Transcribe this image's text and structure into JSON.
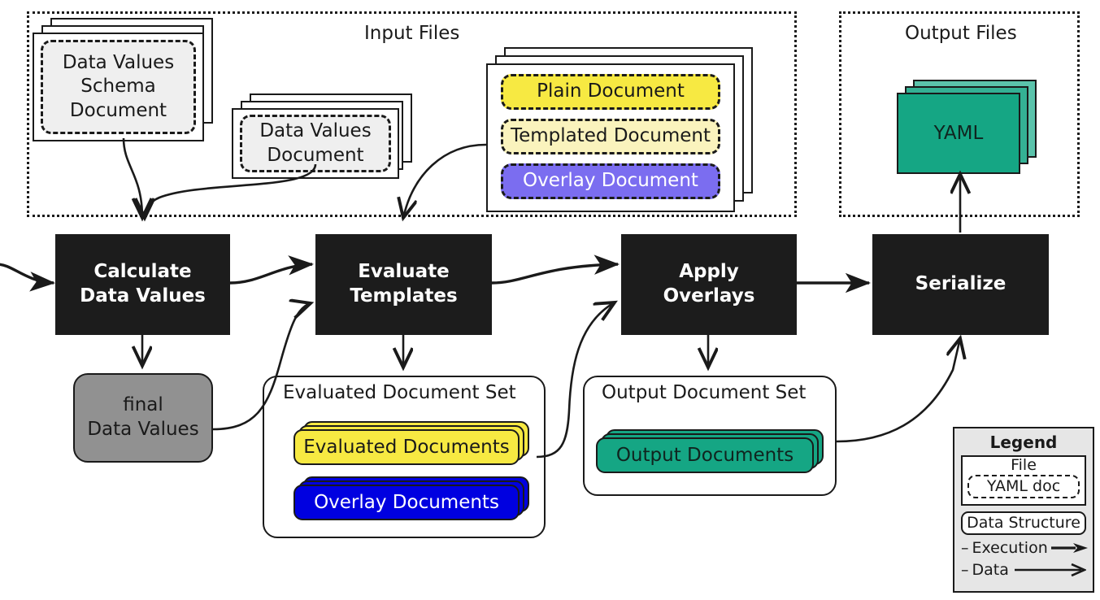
{
  "groups": {
    "input": {
      "title": "Input Files"
    },
    "output": {
      "title": "Output Files"
    }
  },
  "input_files": [
    {
      "name": "data-values-schema-document",
      "label": "Data Values\nSchema\nDocument",
      "style": "plain-dashed"
    },
    {
      "name": "data-values-document",
      "label": "Data Values\nDocument",
      "style": "plain-dashed"
    }
  ],
  "template_file": {
    "docs": [
      {
        "name": "plain-document",
        "label": "Plain Document",
        "color": "#f7e942"
      },
      {
        "name": "templated-document",
        "label": "Templated Document",
        "color": "#faf3bd"
      },
      {
        "name": "overlay-document",
        "label": "Overlay Document",
        "color": "#7b6df0"
      }
    ]
  },
  "output_file": {
    "label": "YAML",
    "color": "#15a684"
  },
  "processes": [
    {
      "name": "calculate-data-values",
      "line1": "Calculate",
      "line2": "Data Values"
    },
    {
      "name": "evaluate-templates",
      "line1": "Evaluate",
      "line2": "Templates"
    },
    {
      "name": "apply-overlays",
      "line1": "Apply",
      "line2": "Overlays"
    },
    {
      "name": "serialize",
      "line1": "Serialize",
      "line2": ""
    }
  ],
  "data_structures": {
    "final_data_values": {
      "line1": "final",
      "line2": "Data Values",
      "color": "#919191"
    },
    "evaluated_document_set": {
      "title": "Evaluated Document Set",
      "chips": [
        {
          "name": "evaluated-documents",
          "label": "Evaluated Documents",
          "color": "#f7e942"
        },
        {
          "name": "overlay-documents",
          "label": "Overlay Documents",
          "color": "#0000e0"
        }
      ]
    },
    "output_document_set": {
      "title": "Output Document Set",
      "chips": [
        {
          "name": "output-documents",
          "label": "Output Documents",
          "color": "#15a684"
        }
      ]
    }
  },
  "legend": {
    "title": "Legend",
    "file_label": "File",
    "yaml_doc_label": "YAML doc",
    "data_structure_label": "Data Structure",
    "execution_dash": "–",
    "execution_label": "Execution",
    "data_dash": "–",
    "data_label": "Data"
  }
}
